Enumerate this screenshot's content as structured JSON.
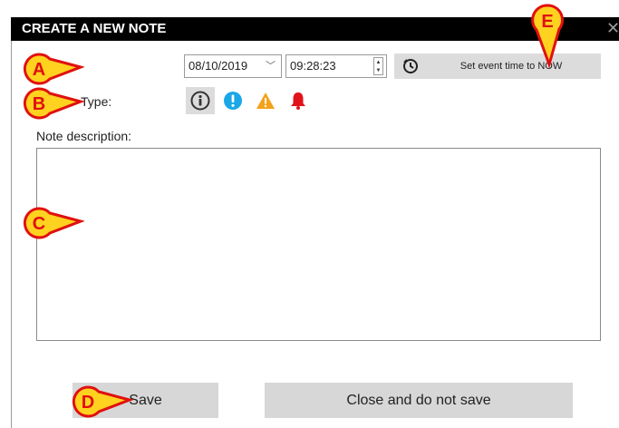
{
  "dialog": {
    "title": "CREATE A NEW NOTE",
    "close_symbol": "✕"
  },
  "event_time": {
    "date_value": "08/10/2019",
    "time_value": "09:28:23",
    "now_button_label": "Set event time to NOW",
    "now_icon": "clock-icon"
  },
  "note_type": {
    "label": "Type:",
    "types": [
      {
        "icon": "info-icon",
        "color": "#333333",
        "selected": true
      },
      {
        "icon": "exclamation-icon",
        "color": "#1aa7e8",
        "selected": false
      },
      {
        "icon": "warning-icon",
        "color": "#f4a21b",
        "selected": false
      },
      {
        "icon": "bell-icon",
        "color": "#e0121a",
        "selected": false
      }
    ]
  },
  "description": {
    "label": "Note description:",
    "value": ""
  },
  "actions": {
    "save_label": "Save",
    "close_label": "Close and do not save"
  },
  "callouts": {
    "a": "A",
    "b": "B",
    "c": "C",
    "d": "D",
    "e": "E",
    "fill_color": "#ffd21f",
    "border_color": "#e01010"
  }
}
